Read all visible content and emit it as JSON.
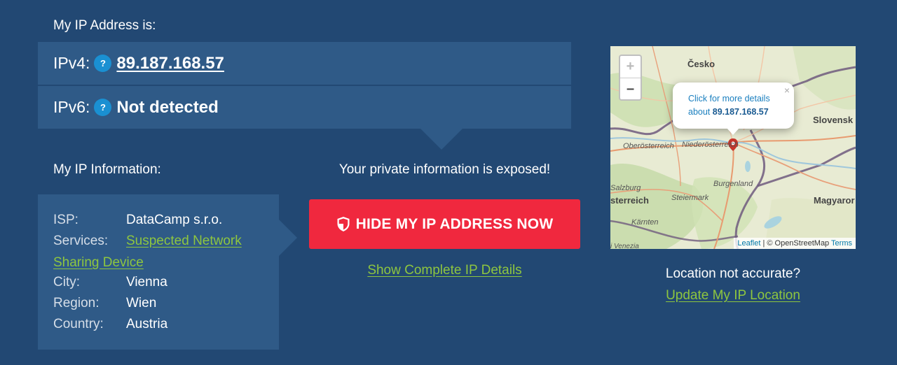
{
  "ip_section": {
    "heading": "My IP Address is:",
    "ipv4_label": "IPv4:",
    "ipv4_value": "89.187.168.57",
    "ipv6_label": "IPv6:",
    "ipv6_value": "Not detected",
    "help_glyph": "?"
  },
  "info_section": {
    "heading": "My IP Information:",
    "rows": [
      {
        "key": "ISP:",
        "value": "DataCamp s.r.o."
      },
      {
        "key": "Services:",
        "value_part1": "Suspected Network",
        "value_part2": "Sharing Device"
      },
      {
        "key": "City:",
        "value": "Vienna"
      },
      {
        "key": "Region:",
        "value": "Wien"
      },
      {
        "key": "Country:",
        "value": "Austria"
      }
    ]
  },
  "warning": {
    "text": "Your private information is exposed!",
    "button_label": "HIDE MY IP ADDRESS NOW",
    "details_link": "Show Complete IP Details"
  },
  "map": {
    "zoom_in": "+",
    "zoom_out": "–",
    "popup_line1": "Click for more details",
    "popup_about": "about",
    "popup_ip": "89.187.168.57",
    "popup_close": "×",
    "attribution_leaflet": "Leaflet",
    "attribution_sep": "|",
    "attribution_osm": "© OpenStreetMap",
    "attribution_terms": "Terms",
    "labels": {
      "cesko": "Česko",
      "slovensk": "Slovensk",
      "oberosterreich": "Oberösterreich",
      "niederosterreich": "Niederösterreich",
      "burgenland": "Burgenland",
      "salzburg": "Salzburg",
      "sterreich": "sterreich",
      "steiermark": "Steiermark",
      "magyarors": "Magyaror",
      "karnten": "Kärnten",
      "venezia": "i Venezia"
    }
  },
  "location": {
    "question": "Location not accurate?",
    "update_link": "Update My IP Location"
  },
  "colors": {
    "background": "#224873",
    "panel": "#2f5a87",
    "accent_red": "#f0283e",
    "link_green": "#8ec63f",
    "help_blue": "#1a90d2"
  }
}
